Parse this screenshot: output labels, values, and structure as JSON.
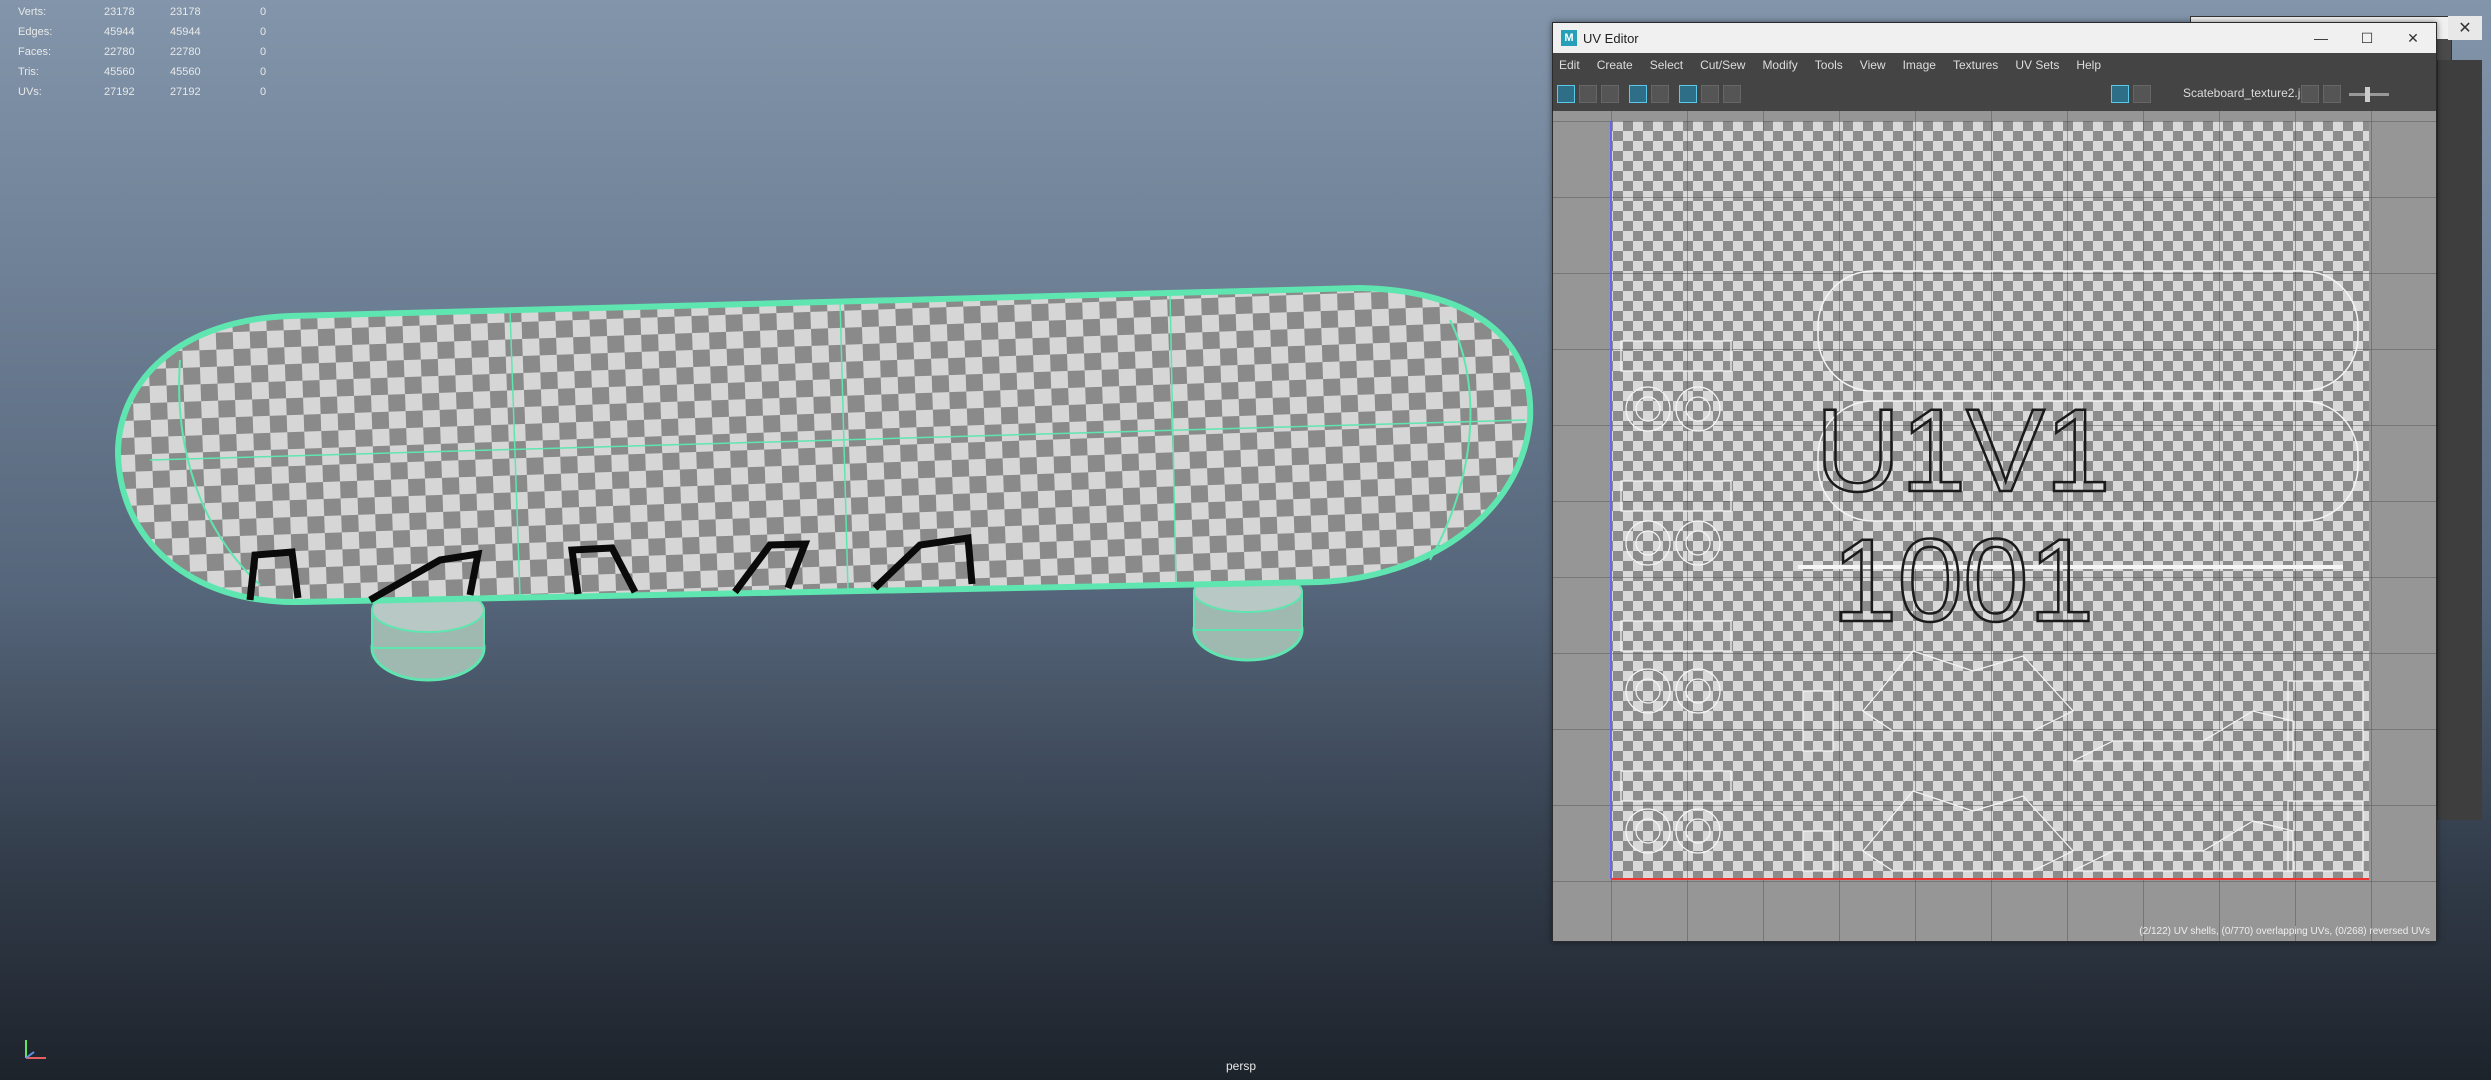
{
  "hud": {
    "rows": [
      {
        "label": "Verts:",
        "v1": "23178",
        "v2": "23178",
        "v3": "0"
      },
      {
        "label": "Edges:",
        "v1": "45944",
        "v2": "45944",
        "v3": "0"
      },
      {
        "label": "Faces:",
        "v1": "22780",
        "v2": "22780",
        "v3": "0"
      },
      {
        "label": "Tris:",
        "v1": "45560",
        "v2": "45560",
        "v3": "0"
      },
      {
        "label": "UVs:",
        "v1": "27192",
        "v2": "27192",
        "v3": "0"
      }
    ]
  },
  "viewport": {
    "camera": "persp"
  },
  "uv_editor": {
    "title": "UV Editor",
    "logo": "M",
    "menu": [
      "Edit",
      "Create",
      "Select",
      "Cut/Sew",
      "Modify",
      "Tools",
      "View",
      "Image",
      "Textures",
      "UV Sets",
      "Help"
    ],
    "texture_name": "Scateboard_texture2.j",
    "tile_label_top": "U1V1",
    "tile_label_bottom": "1001",
    "status": "(2/122) UV shells, (0/770) overlapping UVs, (0/268) reversed UVs",
    "window_buttons": [
      "minimize",
      "maximize",
      "close"
    ]
  },
  "colors": {
    "wireframe": "#5fe6b0",
    "accent": "#25a0b8"
  }
}
